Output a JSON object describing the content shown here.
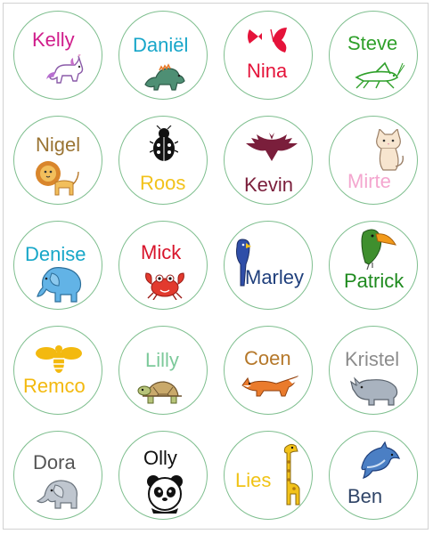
{
  "stickers": [
    {
      "name": "Kelly",
      "color": "#d01d8b",
      "icon": "unicorn-icon"
    },
    {
      "name": "Daniël",
      "color": "#18a6c9",
      "icon": "dinosaur-icon"
    },
    {
      "name": "Nina",
      "color": "#e5133a",
      "icon": "butterfly-icon"
    },
    {
      "name": "Steve",
      "color": "#2fa02a",
      "icon": "grasshopper-icon"
    },
    {
      "name": "Nigel",
      "color": "#9a7433",
      "icon": "lion-icon"
    },
    {
      "name": "Roos",
      "color": "#f2c21a",
      "icon": "ladybug-icon"
    },
    {
      "name": "Kevin",
      "color": "#7a1e3b",
      "icon": "bat-icon"
    },
    {
      "name": "Mirte",
      "color": "#f4a6cf",
      "icon": "cat-icon"
    },
    {
      "name": "Denise",
      "color": "#17a7c8",
      "icon": "elephant-icon"
    },
    {
      "name": "Mick",
      "color": "#d8142b",
      "icon": "crab-icon"
    },
    {
      "name": "Marley",
      "color": "#1f3f7c",
      "icon": "parrot-icon"
    },
    {
      "name": "Patrick",
      "color": "#1e8a1e",
      "icon": "toucan-icon"
    },
    {
      "name": "Remco",
      "color": "#f3b90f",
      "icon": "bee-icon"
    },
    {
      "name": "Lilly",
      "color": "#7cc99a",
      "icon": "turtle-icon"
    },
    {
      "name": "Coen",
      "color": "#b5782a",
      "icon": "fox-icon"
    },
    {
      "name": "Kristel",
      "color": "#8c8c8c",
      "icon": "rhino-icon"
    },
    {
      "name": "Dora",
      "color": "#555555",
      "icon": "baby-elephant-icon"
    },
    {
      "name": "Olly",
      "color": "#111111",
      "icon": "panda-icon"
    },
    {
      "name": "Lies",
      "color": "#f0c315",
      "icon": "giraffe-icon"
    },
    {
      "name": "Ben",
      "color": "#2f4467",
      "icon": "dolphin-icon"
    }
  ]
}
